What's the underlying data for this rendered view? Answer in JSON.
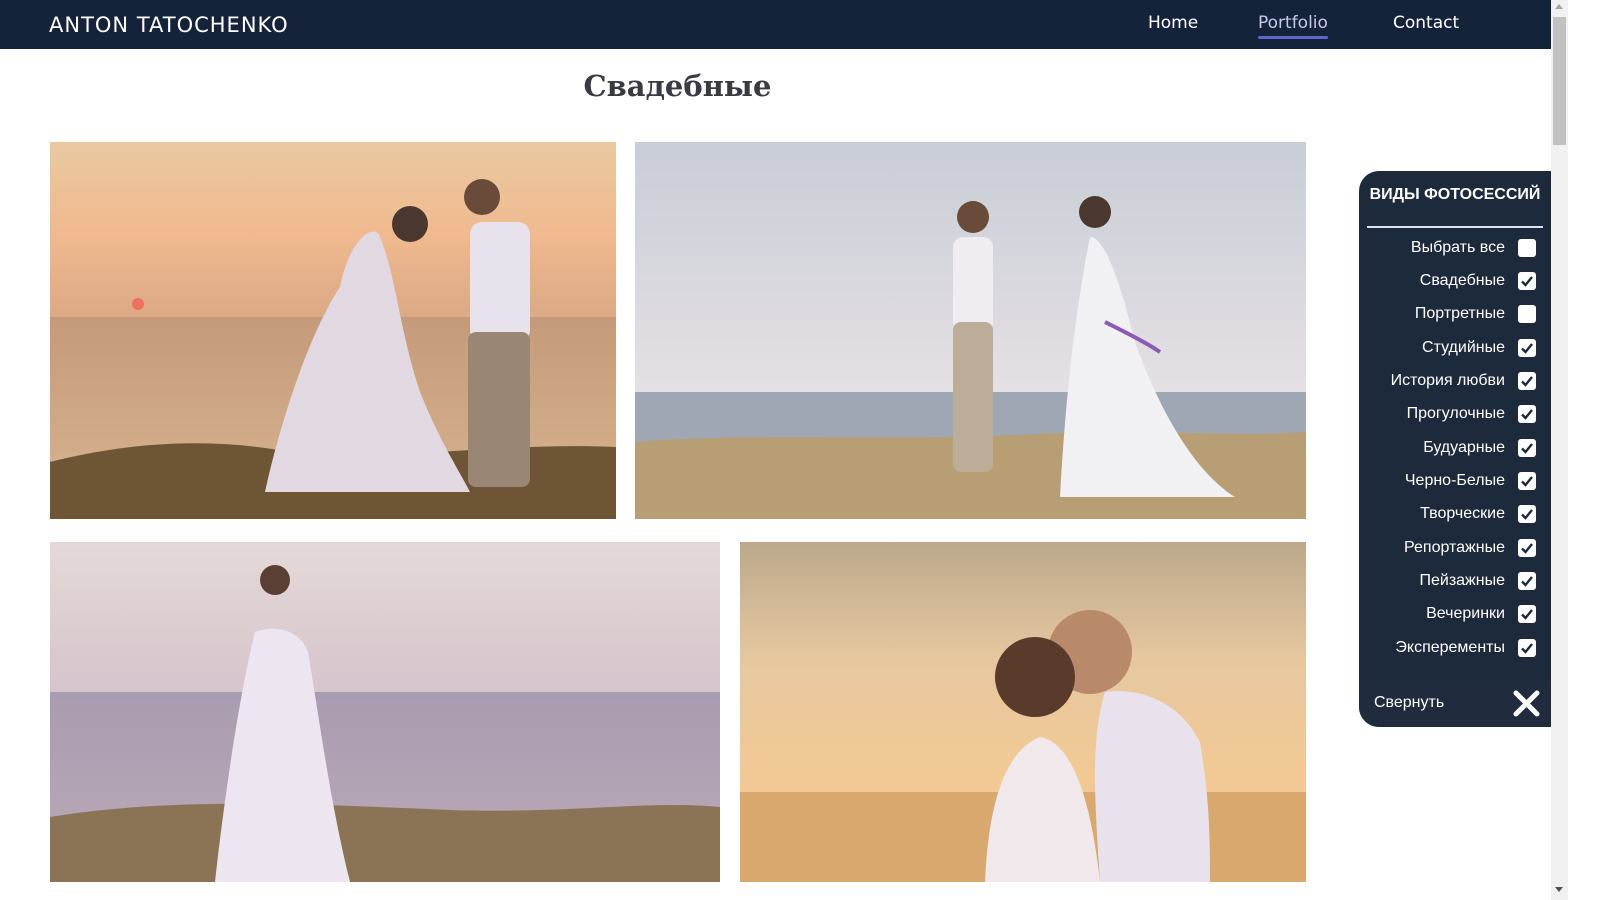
{
  "header": {
    "brand": "ANTON TATOCHENKO",
    "nav": {
      "home": "Home",
      "portfolio": "Portfolio",
      "contact": "Contact"
    },
    "active_item": "Portfolio"
  },
  "page_title": "Свадебные",
  "photos": [
    "wedding-couple-sunset-cliff-photo",
    "wedding-couple-walking-field-photo",
    "bride-standing-sea-photo",
    "couple-embracing-sunset-photo"
  ],
  "filter_panel": {
    "title": "ВИДЫ ФОТОСЕССИЙ",
    "items": [
      {
        "label": "Выбрать все",
        "checked": false
      },
      {
        "label": "Свадебные",
        "checked": true
      },
      {
        "label": "Портретные",
        "checked": false
      },
      {
        "label": "Студийные",
        "checked": true
      },
      {
        "label": "История любви",
        "checked": true
      },
      {
        "label": "Прогулочные",
        "checked": true
      },
      {
        "label": "Будуарные",
        "checked": true
      },
      {
        "label": "Черно-Белые",
        "checked": true
      },
      {
        "label": "Творческие",
        "checked": true
      },
      {
        "label": "Репортажные",
        "checked": true
      },
      {
        "label": "Пейзажные",
        "checked": true
      },
      {
        "label": "Вечеринки",
        "checked": true
      },
      {
        "label": "Эксперементы",
        "checked": true
      }
    ],
    "collapse_label": "Свернуть",
    "close_icon": "close-x-icon"
  },
  "colors": {
    "header_bg": "#15233a",
    "active_nav": "#c9c9ee",
    "nav_underline": "#6464c8",
    "panel_bg": "#1d2a3c"
  }
}
